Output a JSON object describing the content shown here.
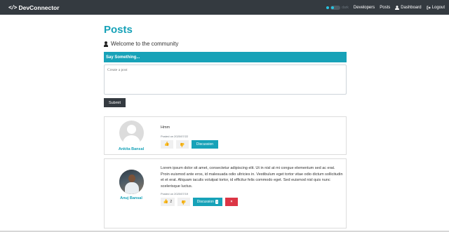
{
  "navbar": {
    "brand_icon": "</>",
    "brand": "DevConnector",
    "toggle_label": "dark",
    "links": [
      {
        "label": "Developers",
        "icon": ""
      },
      {
        "label": "Posts",
        "icon": ""
      },
      {
        "label": "Dashboard",
        "icon": "user-icon"
      },
      {
        "label": "Logout",
        "icon": "sign-out-icon"
      }
    ]
  },
  "page": {
    "title": "Posts",
    "lead": "Welcome to the community"
  },
  "form": {
    "header": "Say Something...",
    "placeholder": "Create a post",
    "submit": "Submit"
  },
  "posts": [
    {
      "author": "Ankita Bansal",
      "avatar": "default-avatar",
      "text": "Hmm",
      "date": "Posted on 2020/07/22",
      "likes": "",
      "discussion_label": "Discussion",
      "comment_count": ""
    },
    {
      "author": "Anuj Bansal",
      "avatar": "photo-avatar",
      "text": "Lorem ipsum dolor sit amet, consectetur adipiscing elit. Ut in nisl at mi congue elementum sed ac erat. Proin euismod ante eros, id malesuada odio ultricies in. Vestibulum eget tortor vitae odio dictum sollicitudin et et erat. Aliquam iaculis volutpat tortor, id efficitur felis commodo eget. Sed euismod nisl quis nunc scelerisque luctus.",
      "date": "Posted on 2020/07/19",
      "likes": "2",
      "discussion_label": "Discussion",
      "comment_count": "1",
      "delete_label": "×"
    }
  ],
  "colors": {
    "navbar": "#343a40",
    "accent": "#17a2b8",
    "danger": "#dc3545"
  }
}
